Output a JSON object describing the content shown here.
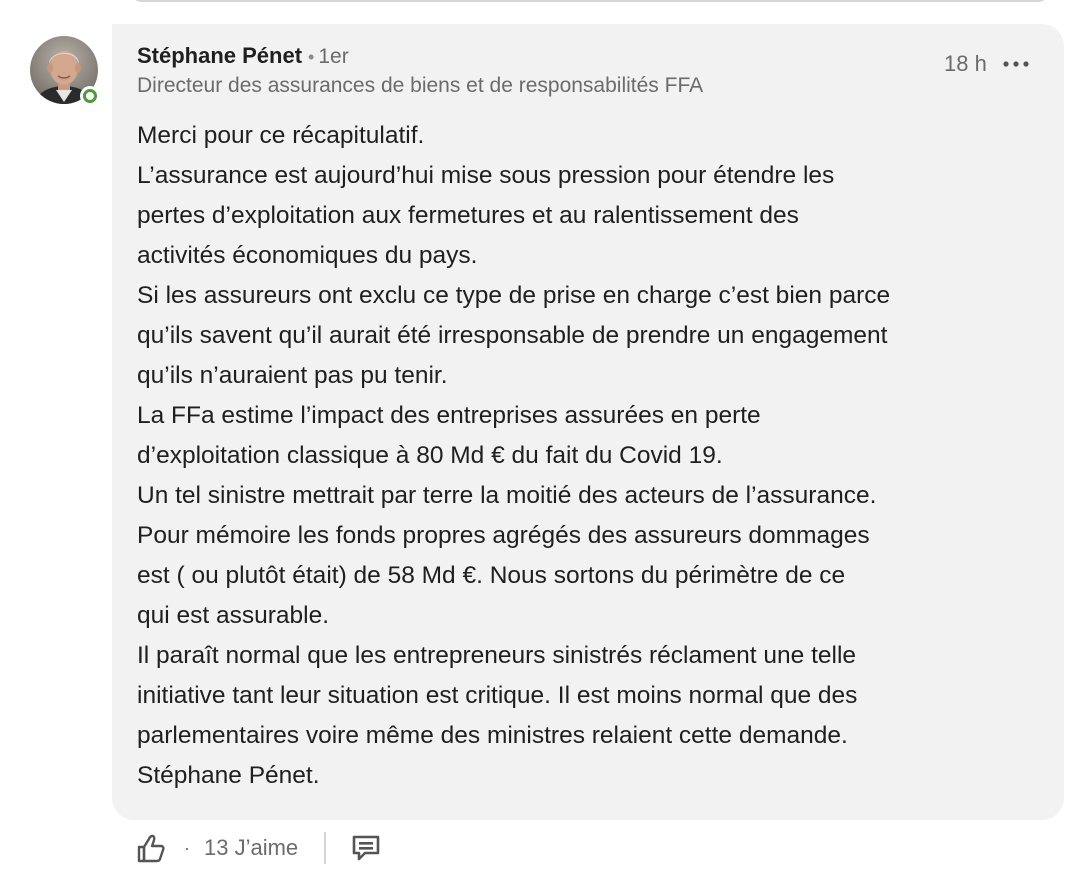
{
  "comment": {
    "author": {
      "name": "Stéphane Pénet",
      "separator": "•",
      "degree": "1er",
      "headline": "Directeur des assurances de biens et de responsabilités FFA",
      "avatar_icon": "profile-photo",
      "online": true
    },
    "timestamp": "18 h",
    "more_icon": "ellipsis-icon",
    "body_lines": [
      "Merci pour ce récapitulatif.",
      "L’assurance est aujourd’hui mise sous pression pour étendre les",
      "pertes d’exploitation aux fermetures et au ralentissement des",
      "activités économiques du pays.",
      "Si les assureurs ont exclu ce type de prise en charge c’est bien parce",
      "qu’ils savent qu’il aurait été irresponsable de prendre un engagement",
      "qu’ils n’auraient pas pu tenir.",
      "La FFa estime l’impact des entreprises assurées en perte",
      "d’exploitation classique à 80 Md € du fait du Covid 19.",
      "Un tel sinistre mettrait par terre la moitié des acteurs de l’assurance.",
      "Pour mémoire les fonds propres agrégés des assureurs dommages",
      "est ( ou plutôt était) de 58 Md €. Nous sortons du périmètre de ce",
      "qui est assurable.",
      "Il paraît normal que les entrepreneurs sinistrés réclament une telle",
      "initiative tant leur situation est critique. Il est moins normal que des",
      "parlementaires voire même des ministres relaient cette demande.",
      "Stéphane Pénet."
    ]
  },
  "actions": {
    "like_icon": "thumbs-up-icon",
    "separator": "·",
    "like_count_label": "13 J’aime",
    "reply_icon": "comment-icon"
  },
  "colors": {
    "bubble_bg": "#f2f2f2",
    "text_primary": "#1f1f1f",
    "text_secondary": "#6b6b6b",
    "online_green": "#4d9a3b"
  }
}
